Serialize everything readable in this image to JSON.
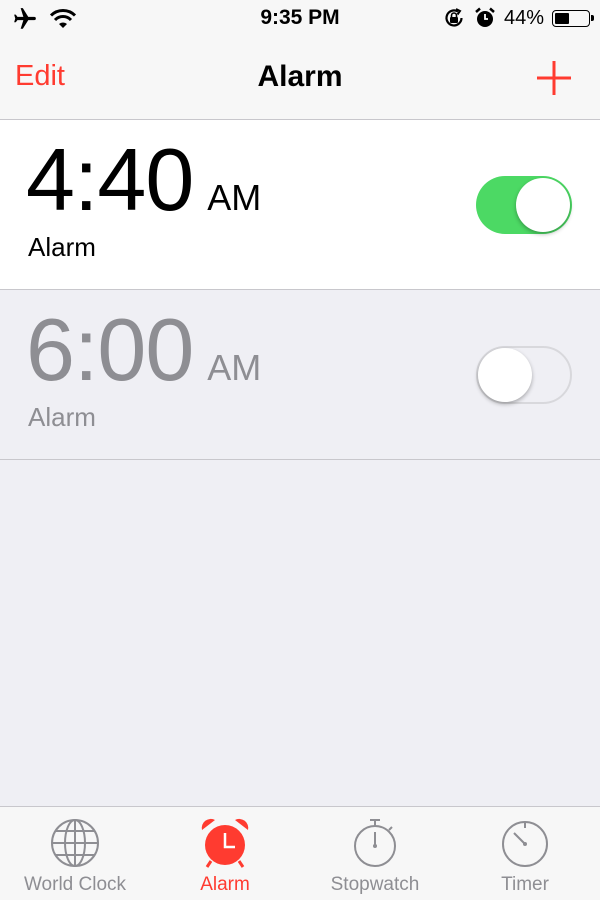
{
  "status_bar": {
    "time": "9:35 PM",
    "battery_percent": "44%",
    "battery_level": 0.44,
    "icons": [
      "airplane-icon",
      "wifi-icon",
      "rotation-lock-icon",
      "alarm-clock-icon",
      "battery-icon"
    ]
  },
  "nav": {
    "edit_label": "Edit",
    "title": "Alarm",
    "add_icon": "plus-icon"
  },
  "alarms": [
    {
      "time": "4:40",
      "period": "AM",
      "label": "Alarm",
      "enabled": true
    },
    {
      "time": "6:00",
      "period": "AM",
      "label": "Alarm",
      "enabled": false
    }
  ],
  "tabs": [
    {
      "label": "World Clock",
      "icon": "globe-icon",
      "active": false
    },
    {
      "label": "Alarm",
      "icon": "alarm-clock-icon",
      "active": true
    },
    {
      "label": "Stopwatch",
      "icon": "stopwatch-icon",
      "active": false
    },
    {
      "label": "Timer",
      "icon": "timer-icon",
      "active": false
    }
  ],
  "colors": {
    "accent": "#ff3b30",
    "toggle_on": "#4cd964",
    "inactive_text": "#8e8e93",
    "background": "#efeff4"
  }
}
